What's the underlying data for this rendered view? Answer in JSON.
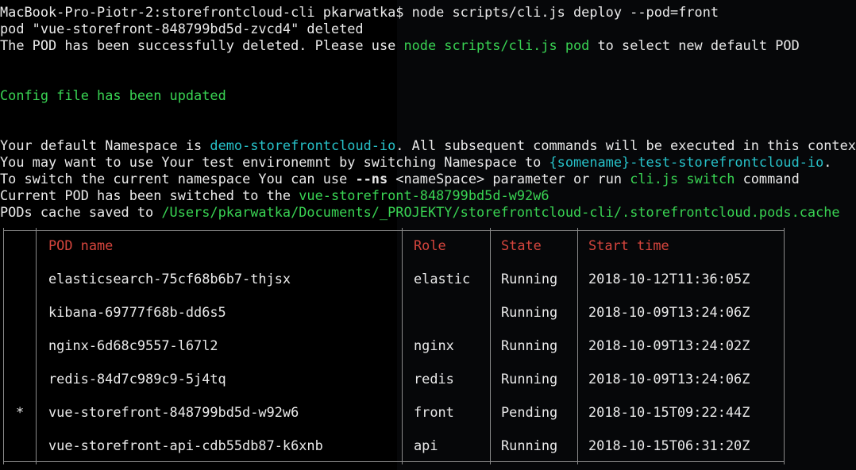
{
  "terminal": {
    "prompt_host": "MacBook-Pro-Piotr-2:storefrontcloud-cli pkarwatka$",
    "command": " node scripts/cli.js deploy --pod=front",
    "deleted_line": "pod \"vue-storefront-848799bd5d-zvcd4\" deleted",
    "success_prefix": "The POD has been successfully deleted. Please use ",
    "success_cmd": "node scripts/cli.js pod",
    "success_suffix": " to select new default POD",
    "config_updated": "Config file has been updated",
    "ns_prefix": "Your default Namespace is ",
    "ns_value": "demo-storefrontcloud-io",
    "ns_suffix": ". All subsequent commands will be executed in this context",
    "switch_prefix": "You may want to use Your test environemnt by switching Namespace to ",
    "switch_value": "{somename}-test-storefrontcloud-io",
    "switch_suffix": ".",
    "howto_prefix": "To switch the current namespace You can use ",
    "howto_flag": "--ns",
    "howto_mid": " <nameSpace> parameter or run ",
    "howto_cmd": "cli.js switch",
    "howto_suffix": " command",
    "pod_switched_prefix": "Current POD has been switched to the ",
    "pod_switched_value": "vue-storefront-848799bd5d-w92w6",
    "cache_prefix": "PODs cache saved to ",
    "cache_path": "/Users/pkarwatka/Documents/_PROJEKTY/storefrontcloud-cli/.storefrontcloud.pods.cache"
  },
  "table": {
    "headers": [
      "POD name",
      "Role",
      "State",
      "Start time"
    ],
    "rows": [
      {
        "mark": "",
        "name": "elasticsearch-75cf68b6b7-thjsx",
        "role": "elastic",
        "state": "Running",
        "start": "2018-10-12T11:36:05Z"
      },
      {
        "mark": "",
        "name": "kibana-69777f68b-dd6s5",
        "role": "",
        "state": "Running",
        "start": "2018-10-09T13:24:06Z"
      },
      {
        "mark": "",
        "name": "nginx-6d68c9557-l67l2",
        "role": "nginx",
        "state": "Running",
        "start": "2018-10-09T13:24:02Z"
      },
      {
        "mark": "",
        "name": "redis-84d7c989c9-5j4tq",
        "role": "redis",
        "state": "Running",
        "start": "2018-10-09T13:24:06Z"
      },
      {
        "mark": "*",
        "name": "vue-storefront-848799bd5d-w92w6",
        "role": "front",
        "state": "Pending",
        "start": "2018-10-15T09:22:44Z"
      },
      {
        "mark": "",
        "name": "vue-storefront-api-cdb55db87-k6xnb",
        "role": "api",
        "state": "Running",
        "start": "2018-10-15T06:31:20Z"
      }
    ]
  },
  "colors": {
    "background": "#000000",
    "text": "#eaeaea",
    "green": "#39d353",
    "cyan": "#27c1c8",
    "header_red": "#d6453d",
    "border": "#8a8a8a"
  }
}
